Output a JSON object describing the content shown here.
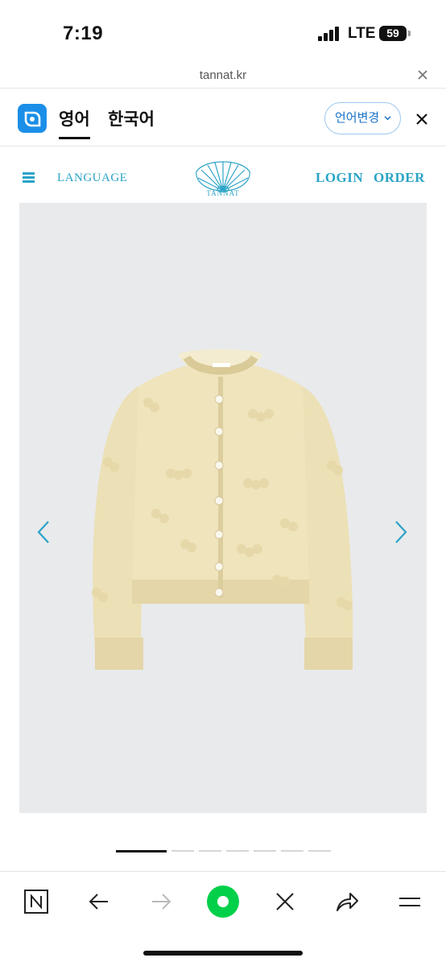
{
  "status_bar": {
    "time": "7:19",
    "network": "LTE",
    "battery": "59"
  },
  "browser": {
    "url": "tannat.kr",
    "close_icon": "close-icon"
  },
  "translate_bar": {
    "tabs": [
      {
        "label": "영어",
        "active": true
      },
      {
        "label": "한국어",
        "active": false
      }
    ],
    "change_language_label": "언어변경",
    "accent": "#1b8fe8"
  },
  "site_header": {
    "menu_icon": "hamburger-icon",
    "language_label": "LANGUAGE",
    "logo_text": "TANNAT",
    "login_label": "LOGIN",
    "order_label": "ORDER",
    "accent": "#2aa3c6"
  },
  "product": {
    "image_icon": "cardigan-image",
    "background": "#e9eaec",
    "prev_icon": "chevron-left-icon",
    "next_icon": "chevron-right-icon",
    "slide_count": 7,
    "active_slide": 1
  },
  "toolbar": {
    "buttons": [
      {
        "name": "naver-home-button",
        "icon": "naver-n-icon"
      },
      {
        "name": "back-button",
        "icon": "arrow-left-icon"
      },
      {
        "name": "forward-button",
        "icon": "arrow-right-icon"
      },
      {
        "name": "green-dot-button",
        "icon": "green-dot-icon"
      },
      {
        "name": "close-tab-button",
        "icon": "close-icon"
      },
      {
        "name": "share-button",
        "icon": "share-icon"
      },
      {
        "name": "menu-button",
        "icon": "menu-icon"
      }
    ]
  }
}
